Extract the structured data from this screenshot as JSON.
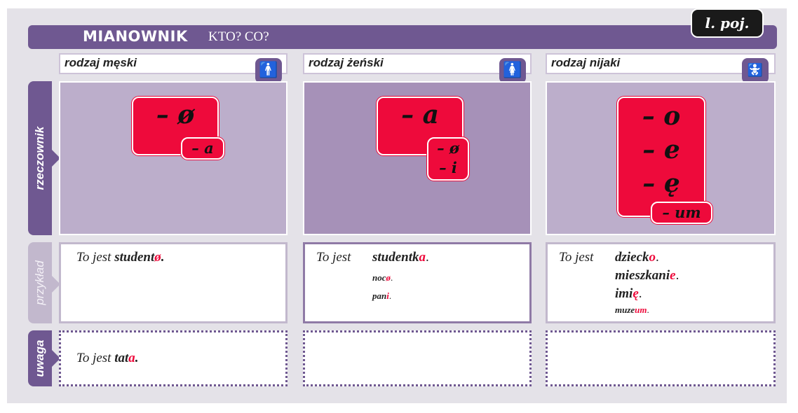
{
  "header": {
    "title": "MIANOWNIK",
    "subtitle": "KTO? CO?",
    "badge": "l. poj."
  },
  "genders": [
    {
      "label": "rodzaj męski",
      "icon": "man-icon"
    },
    {
      "label": "rodzaj żeński",
      "icon": "woman-icon"
    },
    {
      "label": "rodzaj nijaki",
      "icon": "child-icon"
    }
  ],
  "rows": {
    "noun": "rzeczownik",
    "example": "przykład",
    "note": "uwaga"
  },
  "endings": {
    "masc_main": "– ø",
    "masc_sub": "– a",
    "fem_main": "– a",
    "fem_sub1": "– ø",
    "fem_sub2": "– i",
    "neut_1": "– o",
    "neut_2": "– e",
    "neut_3": "– ę",
    "neut_sub": "– um"
  },
  "examples": {
    "intro": "To jest",
    "masc_stem": "student",
    "masc_end": "ø",
    "fem_1_stem": "studentk",
    "fem_1_end": "a",
    "fem_2_stem": "noc",
    "fem_2_end": "ø",
    "fem_3_stem": "pan",
    "fem_3_end": "i",
    "neut_1_stem": "dzieck",
    "neut_1_end": "o",
    "neut_2_stem": "mieszkani",
    "neut_2_end": "e",
    "neut_3_stem": "imi",
    "neut_3_end": "ę",
    "neut_4_stem": "muze",
    "neut_4_end": "um",
    "period": "."
  },
  "note": {
    "intro": "To jest",
    "stem": "tat",
    "end": "a",
    "period": "."
  },
  "colors": {
    "purple": "#6f5891",
    "red": "#ee0a3b"
  }
}
